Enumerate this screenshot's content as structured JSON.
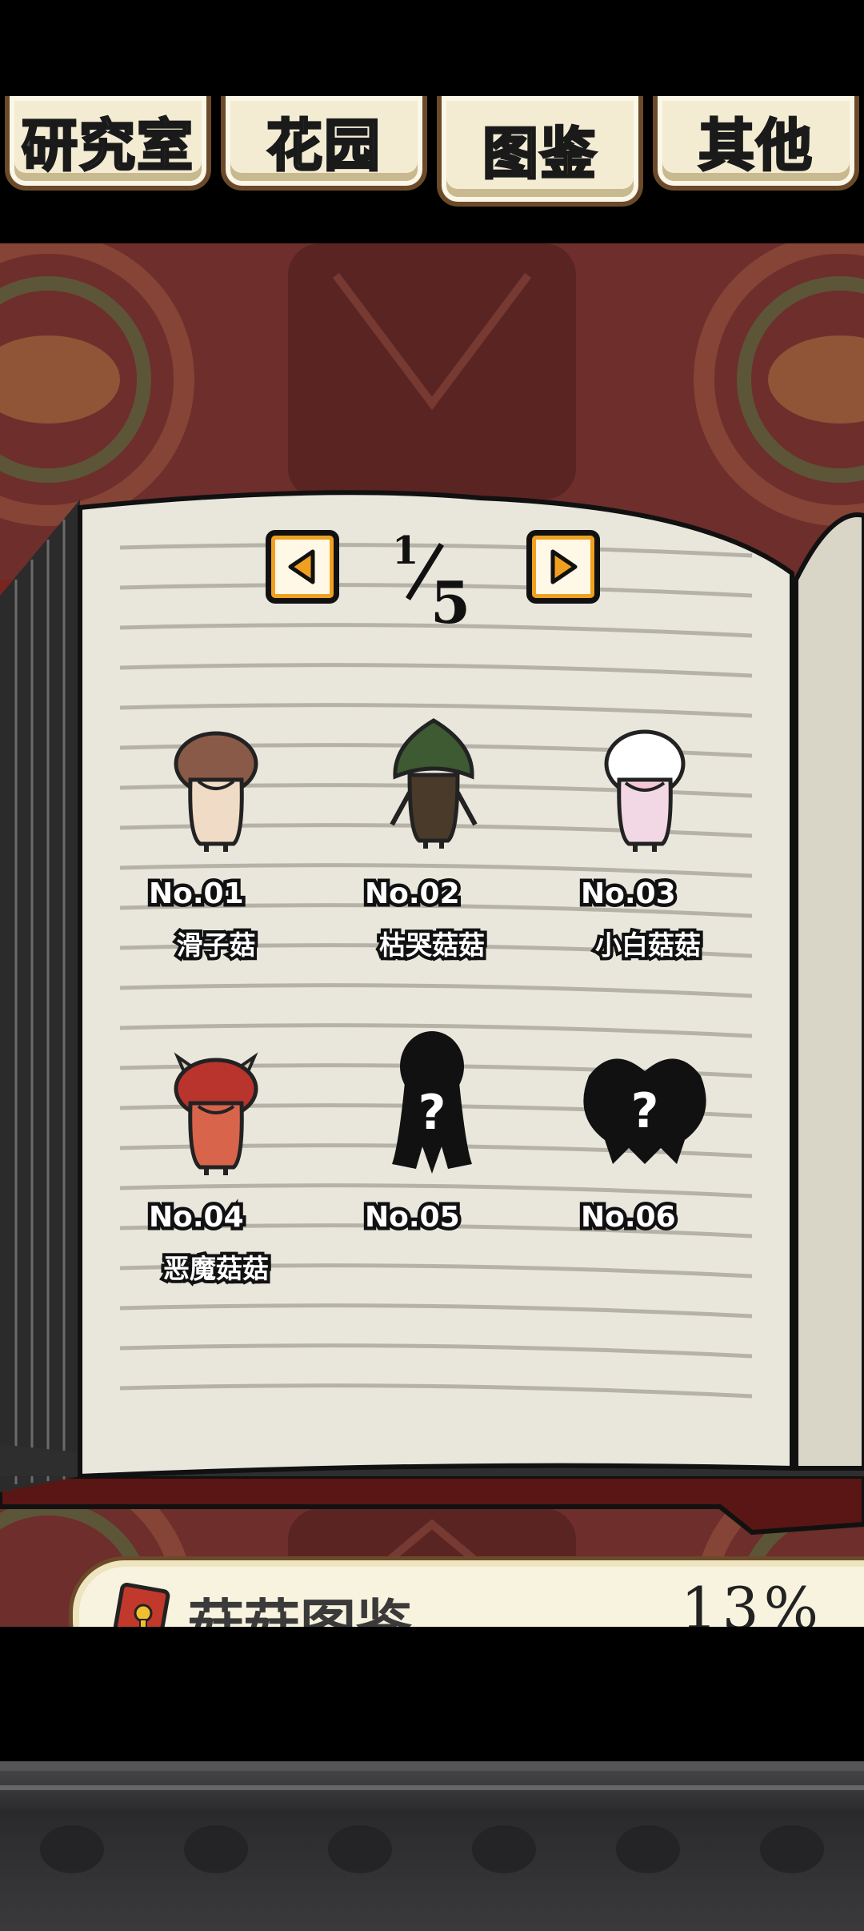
{
  "tabs": [
    {
      "label": "研究室",
      "active": false
    },
    {
      "label": "花园",
      "active": false
    },
    {
      "label": "图鉴",
      "active": true
    },
    {
      "label": "其他",
      "active": false
    }
  ],
  "pager": {
    "current": "1",
    "total": "5"
  },
  "entries": [
    {
      "no": "No.01",
      "name": "滑子菇",
      "unlocked": true,
      "color": "#8a5a48"
    },
    {
      "no": "No.02",
      "name": "枯哭菇菇",
      "unlocked": true,
      "color": "#3d5a33"
    },
    {
      "no": "No.03",
      "name": "小白菇菇",
      "unlocked": true,
      "color": "#f2d8e4"
    },
    {
      "no": "No.04",
      "name": "恶魔菇菇",
      "unlocked": true,
      "color": "#b8342c"
    },
    {
      "no": "No.05",
      "name": "",
      "unlocked": false
    },
    {
      "no": "No.06",
      "name": "",
      "unlocked": false
    }
  ],
  "banner": {
    "title": "菇菇图鉴",
    "percent": "13%",
    "icon": "book-icon"
  },
  "colors": {
    "tab_active_text": "#ffd21c",
    "tab_bg": "#f3ecd3",
    "wallpaper": "#6d2e2c",
    "pager_accent": "#f0a020"
  }
}
